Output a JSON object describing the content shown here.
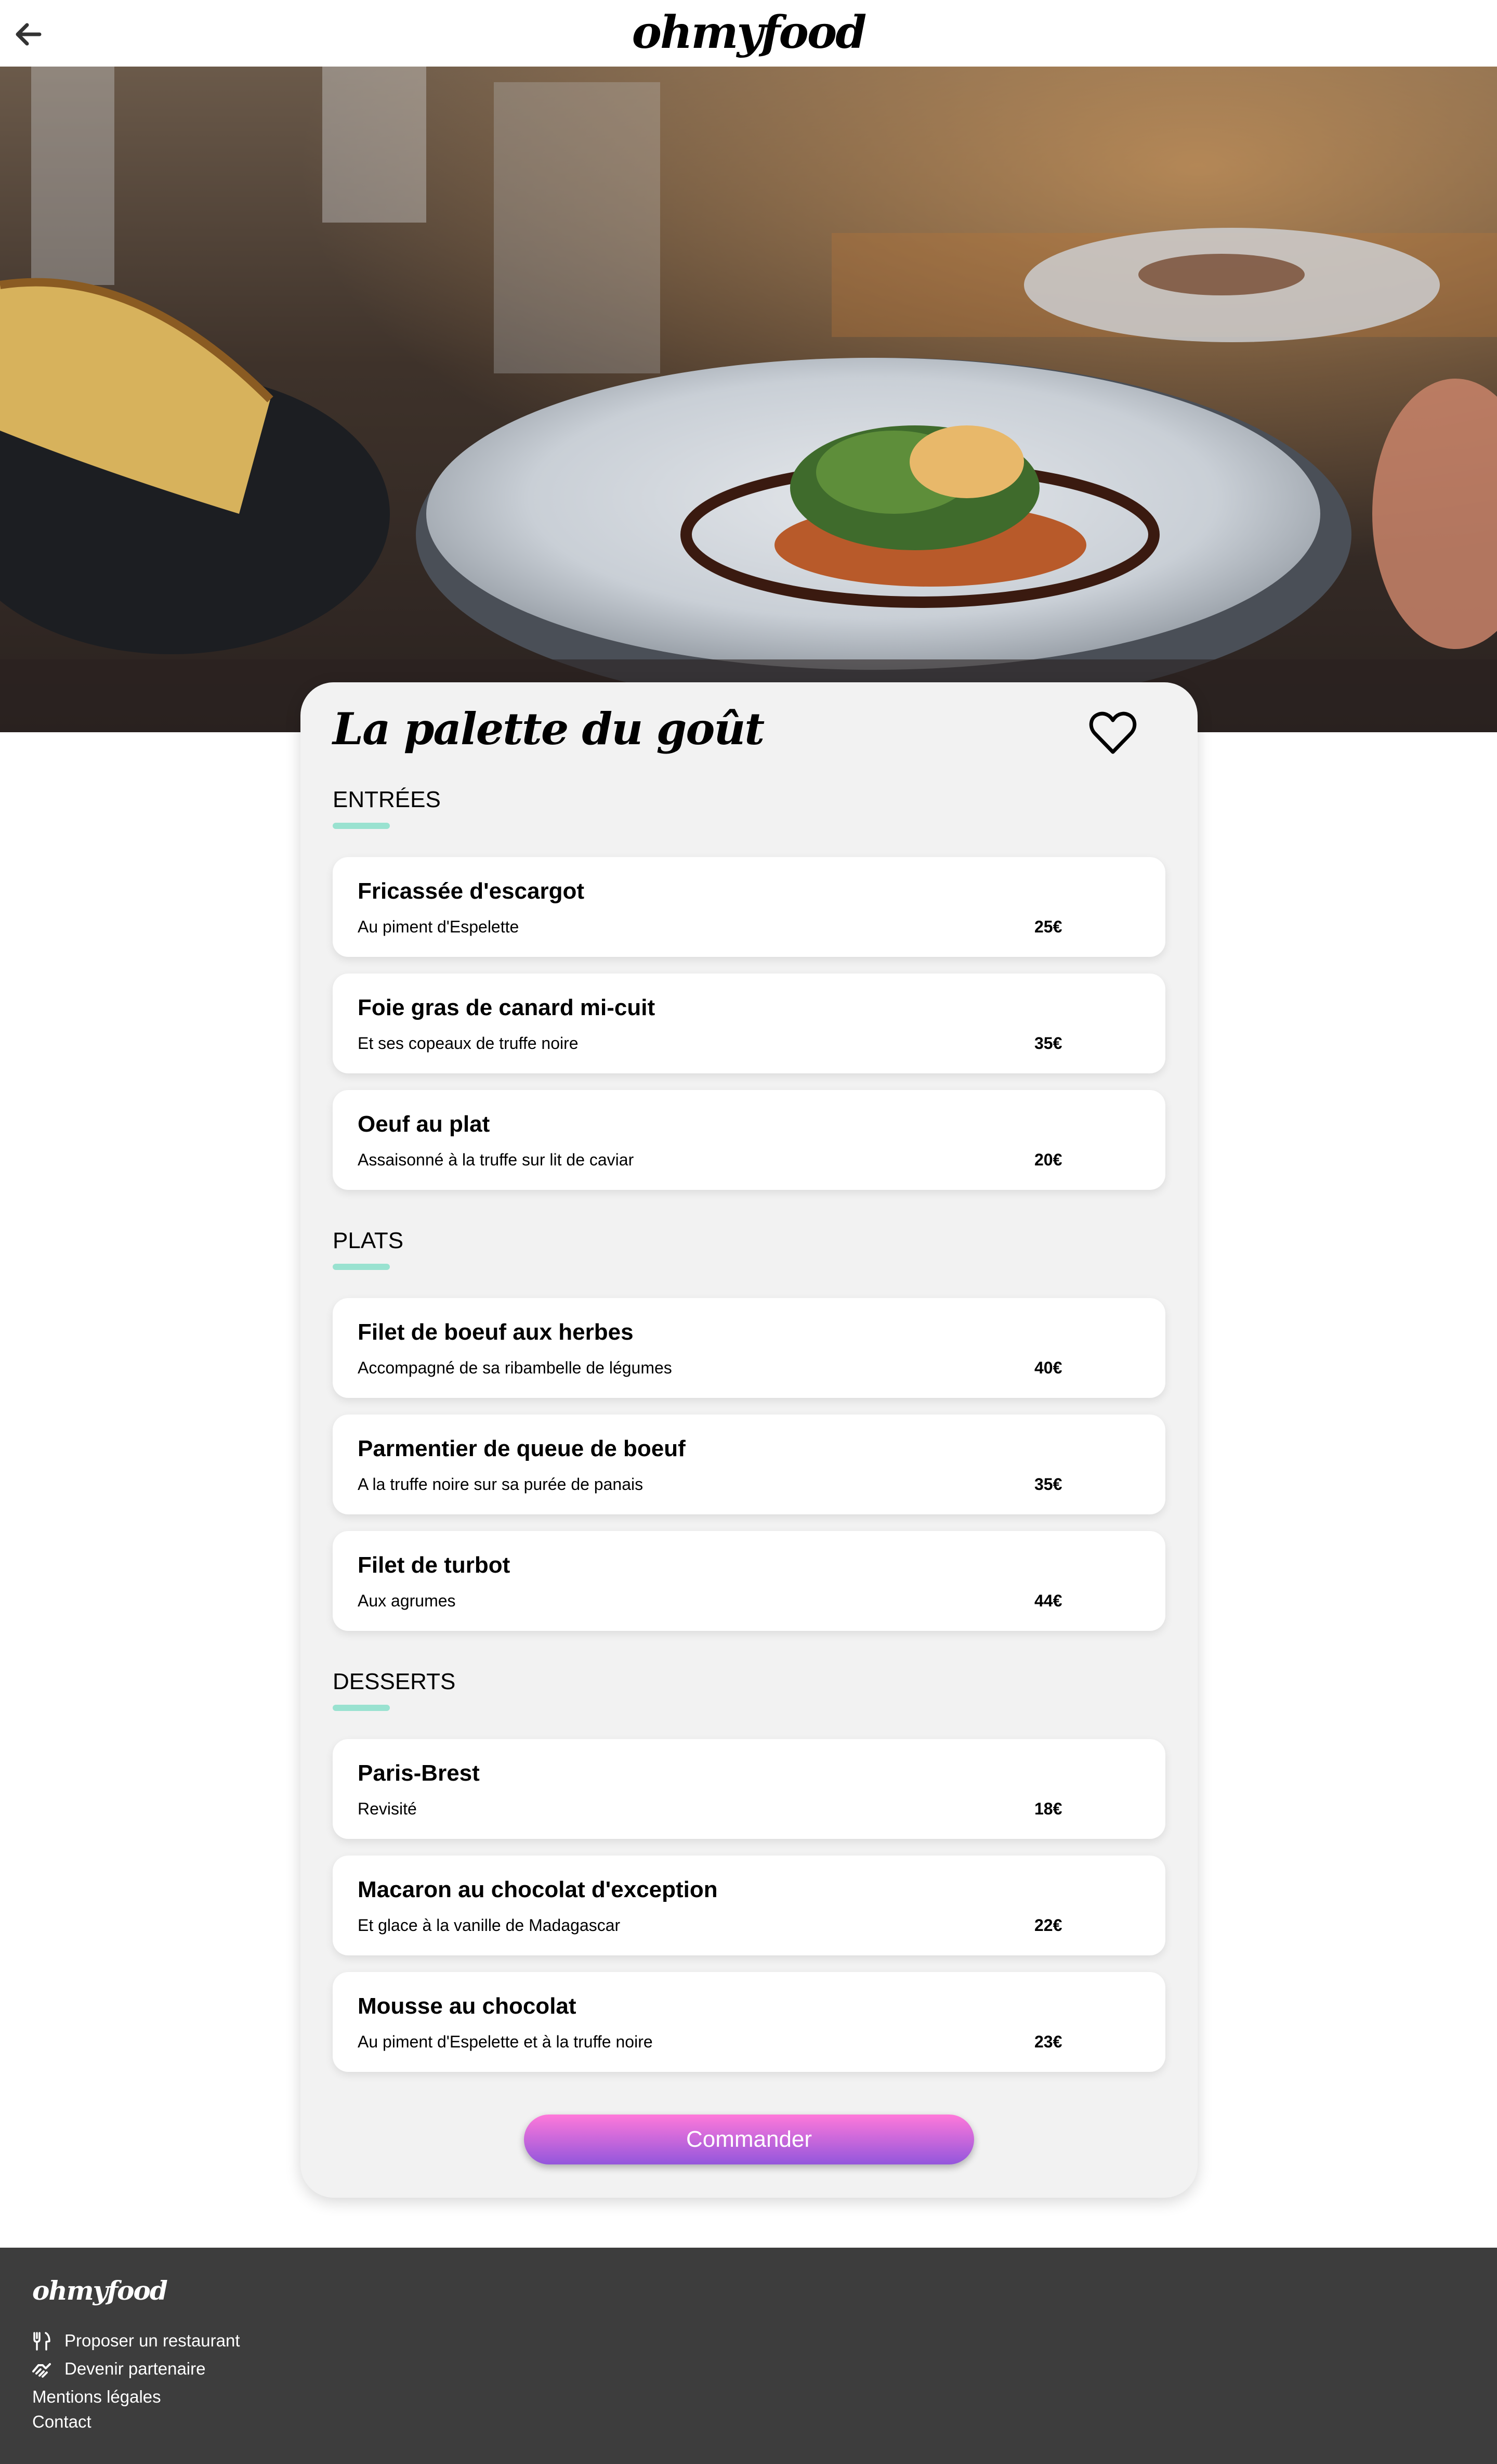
{
  "header": {
    "logo": "ohmyfood",
    "back_icon": "arrow-left-icon"
  },
  "hero": {
    "image_icon": "restaurant-plate-photo"
  },
  "restaurant": {
    "name": "La palette du goût",
    "favorite_icon": "heart-outline-icon"
  },
  "menu": {
    "sections": [
      {
        "title": "ENTRÉES",
        "dishes": [
          {
            "name": "Fricassée d'escargot",
            "description": "Au piment d'Espelette",
            "price": "25€"
          },
          {
            "name": "Foie gras de canard mi-cuit",
            "description": "Et ses copeaux de truffe noire",
            "price": "35€"
          },
          {
            "name": "Oeuf au plat",
            "description": "Assaisonné à la truffe sur lit de caviar",
            "price": "20€"
          }
        ]
      },
      {
        "title": "PLATS",
        "dishes": [
          {
            "name": "Filet de boeuf aux herbes",
            "description": "Accompagné de sa ribambelle de légumes",
            "price": "40€"
          },
          {
            "name": "Parmentier de queue de boeuf",
            "description": "A la truffe noire sur sa purée de panais",
            "price": "35€"
          },
          {
            "name": "Filet de turbot",
            "description": "Aux agrumes",
            "price": "44€"
          }
        ]
      },
      {
        "title": "DESSERTS",
        "dishes": [
          {
            "name": "Paris-Brest",
            "description": "Revisité",
            "price": "18€"
          },
          {
            "name": "Macaron au chocolat d'exception",
            "description": "Et glace à la vanille de Madagascar",
            "price": "22€"
          },
          {
            "name": "Mousse au chocolat",
            "description": "Au piment d'Espelette et à la truffe noire",
            "price": "23€"
          }
        ]
      }
    ],
    "order_label": "Commander"
  },
  "colors": {
    "accent_bar": "#99e2d0",
    "button_top": "#ff79da",
    "button_bottom": "#9356dc",
    "footer_bg": "#3d3d3d",
    "card_bg": "#f2f2f2"
  },
  "footer": {
    "logo": "ohmyfood",
    "links": [
      {
        "label": "Proposer un restaurant",
        "icon": "utensils-icon"
      },
      {
        "label": "Devenir partenaire",
        "icon": "handshake-icon"
      },
      {
        "label": "Mentions légales"
      },
      {
        "label": "Contact"
      }
    ]
  }
}
